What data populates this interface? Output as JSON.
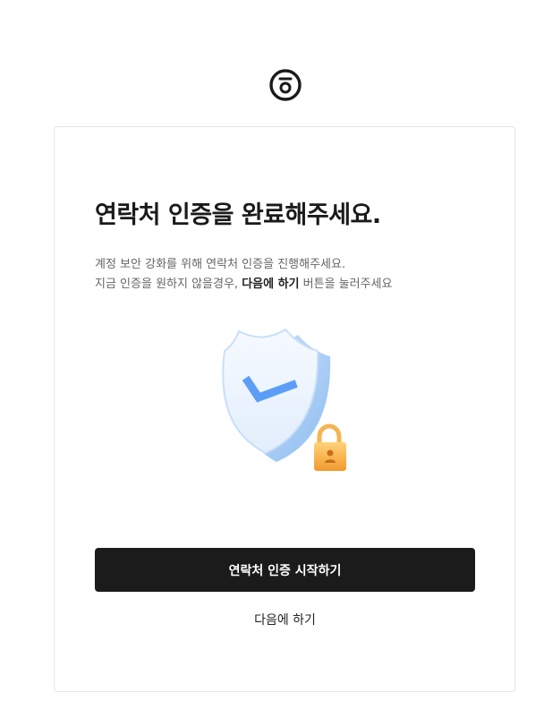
{
  "header": {
    "logo_icon": "circle-logo-icon"
  },
  "card": {
    "title": "연락처 인증을 완료해주세요.",
    "description": {
      "line1": "계정 보안 강화를 위해 연락처 인증을 진행해주세요.",
      "line2_before": "지금 인증을 원하지 않을경우, ",
      "line2_strong": "다음에 하기",
      "line2_after": " 버튼을 눌러주세요"
    },
    "illustration": {
      "icons": [
        "shield-check-icon",
        "padlock-icon"
      ]
    },
    "primary_button_label": "연락처 인증 시작하기",
    "secondary_link_label": "다음에 하기"
  },
  "colors": {
    "primary_button_bg": "#1b1b1b",
    "shield_blue": "#5c9df5",
    "lock_orange": "#f6a53a"
  }
}
